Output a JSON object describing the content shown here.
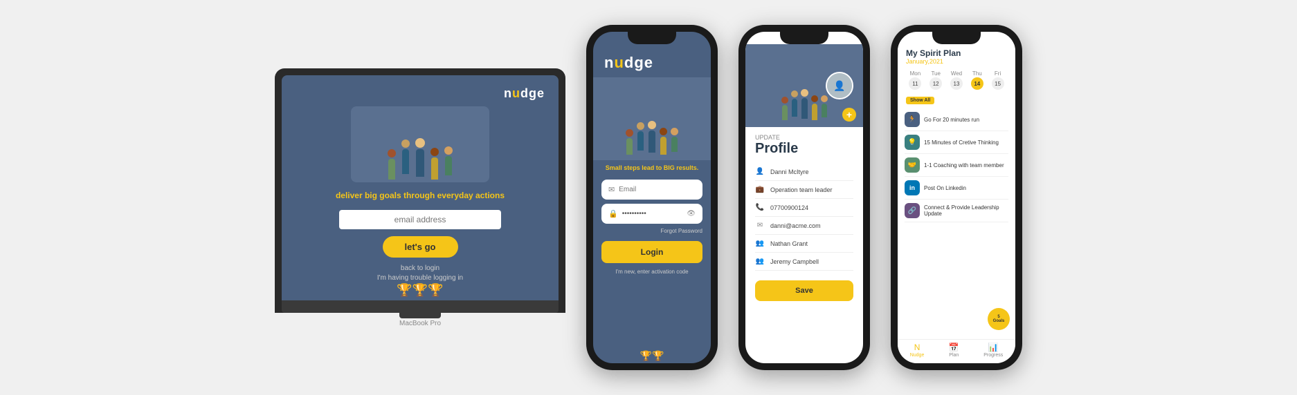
{
  "laptop": {
    "logo": "nudge",
    "tagline": "deliver big goals through everyday actions",
    "email_placeholder": "email address",
    "btn_label": "let's go",
    "back_to_login": "back to login",
    "trouble": "I'm having trouble logging in",
    "model_label": "MacBook Pro"
  },
  "phone1": {
    "logo": "nudge",
    "tagline": "Small steps lead to BIG results.",
    "email_placeholder": "Email",
    "password_placeholder": "••••••••••",
    "forgot_password": "Forgot Password",
    "login_btn": "Login",
    "activate_link": "I'm new, enter activation code"
  },
  "phone2": {
    "update_label": "Update",
    "title": "Profile",
    "name": "Danni McItyre",
    "role": "Operation team leader",
    "phone": "07700900124",
    "email": "danni@acme.com",
    "contact1": "Nathan Grant",
    "contact2": "Jeremy Campbell",
    "save_btn": "Save"
  },
  "phone3": {
    "plan_title": "My Spirit Plan",
    "month": "January,2021",
    "calendar": [
      {
        "day": "Mon",
        "num": "11",
        "today": false
      },
      {
        "day": "Tue",
        "num": "12",
        "today": false
      },
      {
        "day": "Wed",
        "num": "13",
        "today": false
      },
      {
        "day": "Thu",
        "num": "14",
        "today": true
      },
      {
        "day": "Fri",
        "num": "15",
        "today": false
      }
    ],
    "show_all": "Show All",
    "tasks": [
      {
        "icon": "🏃",
        "type": "blue",
        "text": "Go For 20 minutes run"
      },
      {
        "icon": "💡",
        "type": "teal",
        "text": "15 Minutes of Creative Thinking"
      },
      {
        "icon": "🤝",
        "type": "green",
        "text": "1-1 Coaching with team member"
      },
      {
        "icon": "in",
        "type": "linkedin",
        "text": "Post On Linkedin"
      },
      {
        "icon": "🔗",
        "type": "connect",
        "text": "Connect & Provide Leadership Update"
      }
    ],
    "goals_count": "5",
    "goals_label": "Goals",
    "nav": [
      {
        "icon": "N",
        "label": "Nudge",
        "active": true
      },
      {
        "icon": "📅",
        "label": "Plan",
        "active": false
      },
      {
        "icon": "📊",
        "label": "Progress",
        "active": false
      }
    ]
  }
}
